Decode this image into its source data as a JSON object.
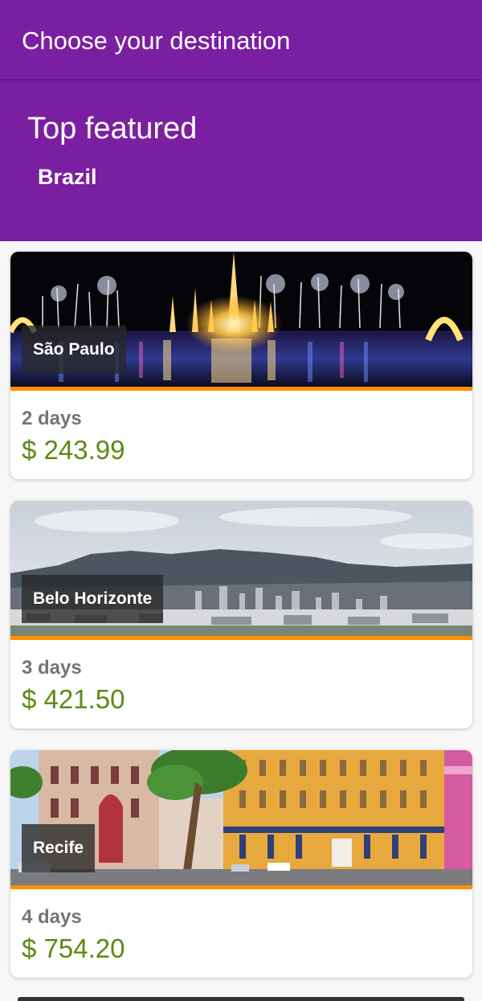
{
  "appbar": {
    "title": "Choose your destination"
  },
  "header": {
    "section_title": "Top featured",
    "country": "Brazil"
  },
  "colors": {
    "primary": "#7b1fa2",
    "accent": "#ff8f00",
    "price": "#5c8a12",
    "duration": "#757575"
  },
  "destinations": [
    {
      "city": "São Paulo",
      "duration": "2 days",
      "price": "$ 243.99",
      "image": "night-fountain-photo"
    },
    {
      "city": "Belo Horizonte",
      "duration": "3 days",
      "price": "$ 421.50",
      "image": "city-mountain-photo"
    },
    {
      "city": "Recife",
      "duration": "4 days",
      "price": "$ 754.20",
      "image": "colonial-buildings-photo"
    }
  ]
}
